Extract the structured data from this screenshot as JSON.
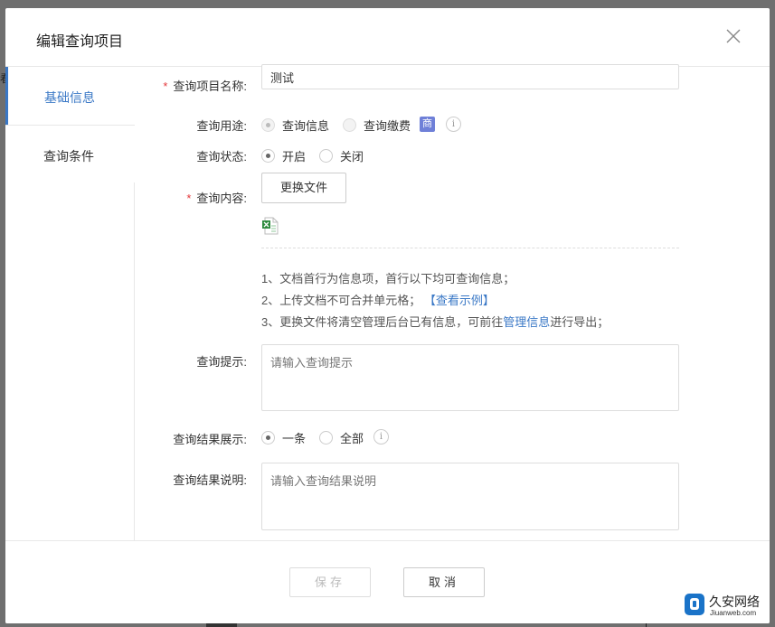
{
  "dialog": {
    "title": "编辑查询项目",
    "close_icon": "close-icon"
  },
  "sidebar": {
    "tabs": [
      {
        "label": "基础信息",
        "active": true
      },
      {
        "label": "查询条件",
        "active": false
      }
    ]
  },
  "form": {
    "name": {
      "required_mark": "*",
      "label": "查询项目名称:",
      "value": "测试"
    },
    "purpose": {
      "label": "查询用途:",
      "options": [
        {
          "label": "查询信息",
          "checked": true,
          "disabled": true
        },
        {
          "label": "查询缴费",
          "checked": false,
          "disabled": true
        }
      ],
      "badge": "商"
    },
    "status": {
      "label": "查询状态:",
      "options": [
        {
          "label": "开启",
          "checked": true
        },
        {
          "label": "关闭",
          "checked": false
        }
      ]
    },
    "content": {
      "required_mark": "*",
      "label": "查询内容:",
      "button": "更换文件",
      "file_icon": "excel-file-icon",
      "notes": {
        "line1": "1、文档首行为信息项，首行以下均可查询信息；",
        "line2_prefix": "2、上传文档不可合并单元格；",
        "line2_link": "【查看示例】",
        "line3_prefix": "3、更换文件将清空管理后台已有信息，可前往",
        "line3_link": "管理信息",
        "line3_suffix": "进行导出；"
      }
    },
    "hint": {
      "label": "查询提示:",
      "placeholder": "请输入查询提示"
    },
    "result_display": {
      "label": "查询结果展示:",
      "options": [
        {
          "label": "一条",
          "checked": true
        },
        {
          "label": "全部",
          "checked": false
        }
      ]
    },
    "result_desc": {
      "label": "查询结果说明:",
      "placeholder": "请输入查询结果说明"
    }
  },
  "footer": {
    "save": "保存",
    "cancel": "取消"
  },
  "watermark": {
    "name": "久安网络",
    "domain": "Jiuanweb.com"
  },
  "colors": {
    "accent": "#3a78c6",
    "required": "#e4393c",
    "badge": "#6f80d8"
  }
}
